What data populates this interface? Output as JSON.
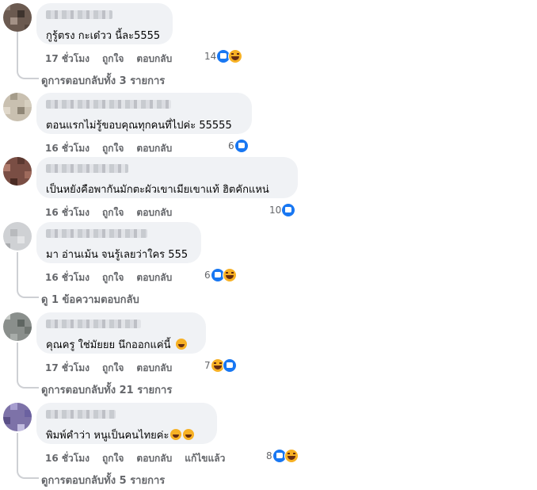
{
  "comments": [
    {
      "text": "กูรู้ตรง กะเด๋วว นี้ละ5555",
      "time": "17 ชั่วโมง",
      "like": "ถูกใจ",
      "reply": "ตอบกลับ",
      "edited": "",
      "count": "14",
      "reactions": [
        "like",
        "haha"
      ],
      "replies_text": "ดูการตอบกลับทั้ง 3 รายการ"
    },
    {
      "text": "ตอนแรกไม่รู้ขอบคุณทุกคนที่ไปค่ะ 55555",
      "time": "16 ชั่วโมง",
      "like": "ถูกใจ",
      "reply": "ตอบกลับ",
      "edited": "",
      "count": "6",
      "reactions": [
        "like"
      ],
      "replies_text": ""
    },
    {
      "text": "เป็นหยังคือพากันมักตะผัวเขาเมียเขาแท้ ฮิตคักแหน่",
      "time": "16 ชั่วโมง",
      "like": "ถูกใจ",
      "reply": "ตอบกลับ",
      "edited": "",
      "count": "10",
      "reactions": [
        "like"
      ],
      "replies_text": ""
    },
    {
      "text": "มา อ่านเม้น จนรู้เลยว่าใคร 555",
      "time": "16 ชั่วโมง",
      "like": "ถูกใจ",
      "reply": "ตอบกลับ",
      "edited": "",
      "count": "6",
      "reactions": [
        "like",
        "haha"
      ],
      "replies_text": "ดู 1 ข้อความตอบกลับ"
    },
    {
      "text": "คุณครู ใช่มัยยย นึกออกแค่นี้",
      "emoji": "grinning-squinting-face",
      "time": "17 ชั่วโมง",
      "like": "ถูกใจ",
      "reply": "ตอบกลับ",
      "edited": "",
      "count": "7",
      "reactions": [
        "haha",
        "like"
      ],
      "replies_text": "ดูการตอบกลับทั้ง 21 รายการ"
    },
    {
      "text": "พิมพ์คำว่า หนูเป็นคนไทยค่ะ",
      "emoji": "rolling-on-floor-laughing x2",
      "time": "16 ชั่วโมง",
      "like": "ถูกใจ",
      "reply": "ตอบกลับ",
      "edited": "แก้ไขแล้ว",
      "count": "8",
      "reactions": [
        "like",
        "haha"
      ],
      "replies_text": "ดูการตอบกลับทั้ง 5 รายการ"
    }
  ],
  "colors": {
    "bubble": "#f0f2f5",
    "meta": "#65676b",
    "like": "#1877f2",
    "haha": "#f7b125"
  }
}
